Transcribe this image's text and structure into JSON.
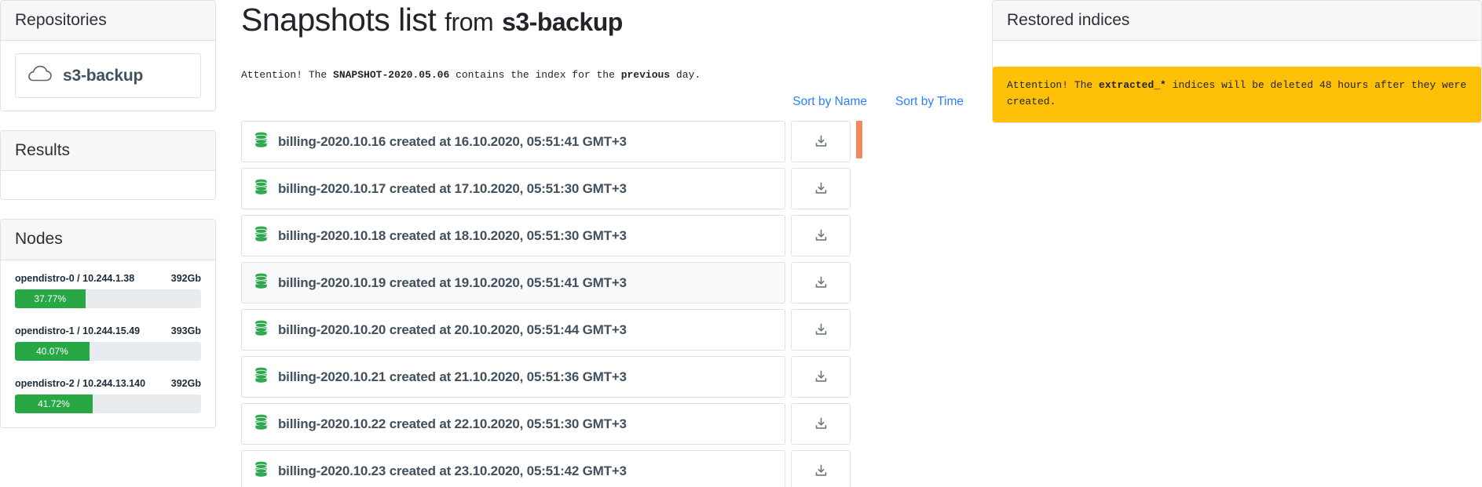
{
  "sidebar": {
    "repositories": {
      "header": "Repositories",
      "repo": {
        "name": "s3-backup",
        "icon": "cloud-icon"
      }
    },
    "results": {
      "header": "Results",
      "body": ""
    },
    "nodes": {
      "header": "Nodes",
      "items": [
        {
          "name": "opendistro-0 / 10.244.1.38",
          "size": "392Gb",
          "percent_label": "37.77%",
          "percent": 37.77
        },
        {
          "name": "opendistro-1 / 10.244.15.49",
          "size": "393Gb",
          "percent_label": "40.07%",
          "percent": 40.07
        },
        {
          "name": "opendistro-2 / 10.244.13.140",
          "size": "392Gb",
          "percent_label": "41.72%",
          "percent": 41.72
        }
      ],
      "bar_color": "#28a745",
      "track_color": "#e9ecef"
    }
  },
  "main": {
    "title_prefix": "Snapshots list",
    "title_middle": "from",
    "title_repo": "s3-backup",
    "attention": {
      "part1": "Attention! The ",
      "snapshot": "SNAPSHOT-2020.05.06",
      "part2": " contains the index for the ",
      "emphasis": "previous",
      "part3": " day."
    },
    "sort": {
      "by_name": "Sort by Name",
      "by_time": "Sort by Time",
      "link_color": "#2a7fff"
    },
    "snapshots": [
      {
        "label": "billing-2020.10.16 created at 16.10.2020, 05:51:41 GMT+3",
        "active": false
      },
      {
        "label": "billing-2020.10.17 created at 17.10.2020, 05:51:30 GMT+3",
        "active": false
      },
      {
        "label": "billing-2020.10.18 created at 18.10.2020, 05:51:30 GMT+3",
        "active": false
      },
      {
        "label": "billing-2020.10.19 created at 19.10.2020, 05:51:41 GMT+3",
        "active": true
      },
      {
        "label": "billing-2020.10.20 created at 20.10.2020, 05:51:44 GMT+3",
        "active": false
      },
      {
        "label": "billing-2020.10.21 created at 21.10.2020, 05:51:36 GMT+3",
        "active": false
      },
      {
        "label": "billing-2020.10.22 created at 22.10.2020, 05:51:30 GMT+3",
        "active": false
      },
      {
        "label": "billing-2020.10.23 created at 23.10.2020, 05:51:42 GMT+3",
        "active": false
      }
    ],
    "row_icon": "database-icon",
    "download_icon": "download-icon",
    "scrollbar_color": "#f08a5d"
  },
  "right": {
    "header": "Restored indices",
    "alert": {
      "part1": "Attention! The ",
      "code": "extracted_*",
      "part2": " indices will be deleted 48 hours after they were created.",
      "bg_color": "#ffc107"
    }
  }
}
